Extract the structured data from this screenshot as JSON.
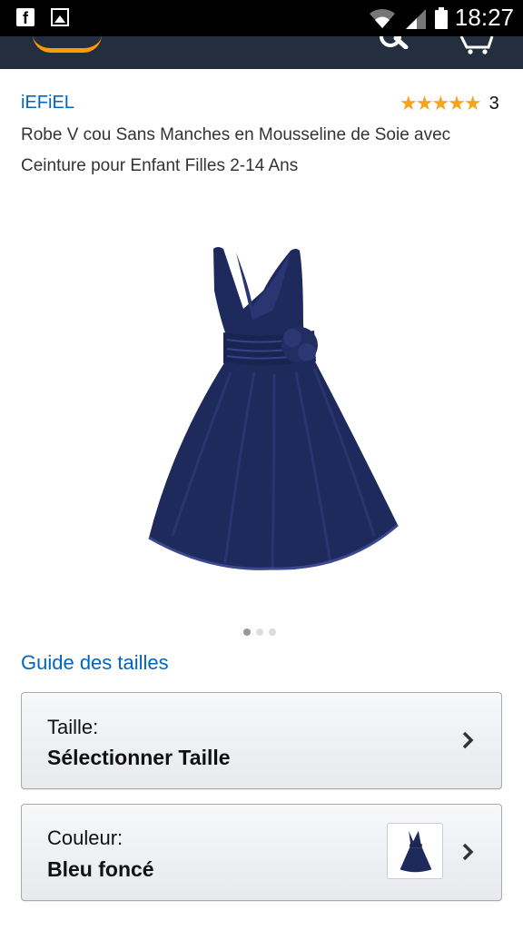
{
  "status_bar": {
    "time": "18:27"
  },
  "product": {
    "brand": "iEFiEL",
    "rating_stars": 4.5,
    "rating_count": "3",
    "title": "Robe V cou Sans Manches en Mousseline de Soie avec Ceinture pour Enfant Filles 2-14 Ans",
    "image_count": 3,
    "active_image": 0,
    "dress_color": "#1f2a5c"
  },
  "size_guide": {
    "label": "Guide des tailles"
  },
  "size_selector": {
    "label": "Taille:",
    "value": "Sélectionner Taille"
  },
  "color_selector": {
    "label": "Couleur:",
    "value": "Bleu foncé"
  },
  "colors": {
    "link": "#0066c0",
    "app_bar": "#232f3e",
    "brand_accent": "#ff9900",
    "star": "#f4a41d"
  }
}
